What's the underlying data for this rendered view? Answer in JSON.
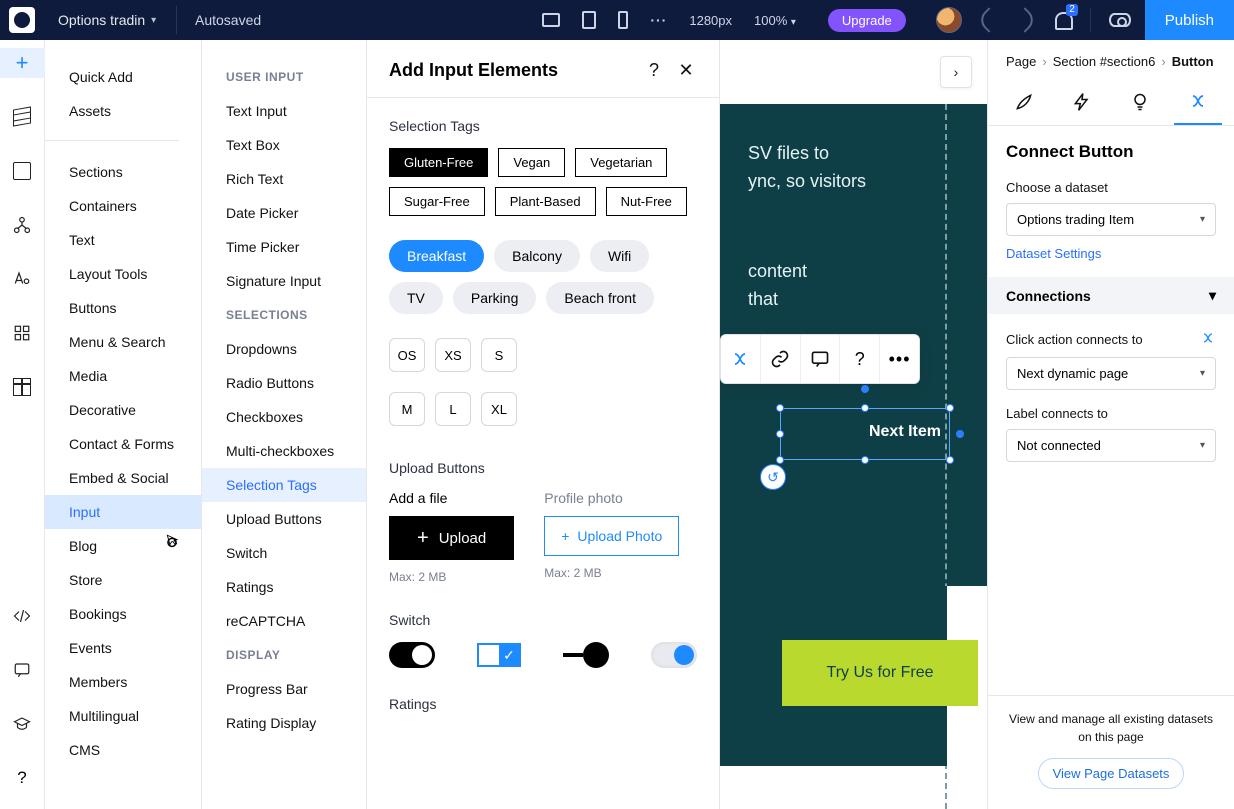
{
  "topbar": {
    "page_name": "Options tradin",
    "save_status": "Autosaved",
    "width_label": "1280px",
    "zoom_label": "100%",
    "upgrade_label": "Upgrade",
    "publish_label": "Publish",
    "notif_count": "2"
  },
  "cat": {
    "quick_add": "Quick Add",
    "assets": "Assets",
    "sections": "Sections",
    "containers": "Containers",
    "text": "Text",
    "layout_tools": "Layout Tools",
    "buttons": "Buttons",
    "menu_search": "Menu & Search",
    "media": "Media",
    "decorative": "Decorative",
    "contact_forms": "Contact & Forms",
    "embed_social": "Embed & Social",
    "input": "Input",
    "blog": "Blog",
    "store": "Store",
    "bookings": "Bookings",
    "events": "Events",
    "members": "Members",
    "multilingual": "Multilingual",
    "cms": "CMS"
  },
  "sub": {
    "head_user_input": "USER INPUT",
    "text_input": "Text Input",
    "text_box": "Text Box",
    "rich_text": "Rich Text",
    "date_picker": "Date Picker",
    "time_picker": "Time Picker",
    "signature_input": "Signature Input",
    "head_selections": "SELECTIONS",
    "dropdowns": "Dropdowns",
    "radio_buttons": "Radio Buttons",
    "checkboxes": "Checkboxes",
    "multi_checkboxes": "Multi-checkboxes",
    "selection_tags": "Selection Tags",
    "upload_buttons": "Upload Buttons",
    "switch": "Switch",
    "ratings": "Ratings",
    "recaptcha": "reCAPTCHA",
    "head_display": "DISPLAY",
    "progress_bar": "Progress Bar",
    "rating_display": "Rating Display"
  },
  "panel": {
    "title": "Add Input Elements",
    "sec_selection_tags": "Selection Tags",
    "tags1": {
      "a": "Gluten-Free",
      "b": "Vegan",
      "c": "Vegetarian",
      "d": "Sugar-Free",
      "e": "Plant-Based",
      "f": "Nut-Free"
    },
    "pills": {
      "a": "Breakfast",
      "b": "Balcony",
      "c": "Wifi",
      "d": "TV",
      "e": "Parking",
      "f": "Beach front"
    },
    "sizes": {
      "a": "OS",
      "b": "XS",
      "c": "S",
      "d": "M",
      "e": "L",
      "f": "XL"
    },
    "sec_upload_buttons": "Upload Buttons",
    "upload_add_label": "Add a file",
    "upload_btn": "Upload",
    "upload_max": "Max: 2 MB",
    "profile_label": "Profile photo",
    "profile_btn": "Upload Photo",
    "profile_max": "Max: 2 MB",
    "sec_switch": "Switch",
    "sec_ratings": "Ratings"
  },
  "canvas": {
    "hero_line1": "SV files to",
    "hero_line2": "ync, so visitors",
    "hero_line3": "content",
    "hero_line4": "that",
    "selected_label": "Next Item",
    "cta_label": "Try Us for Free"
  },
  "inspector": {
    "crumb_page": "Page",
    "crumb_section": "Section #section6",
    "crumb_button": "Button",
    "title": "Connect Button",
    "choose_dataset": "Choose a dataset",
    "dataset_value": "Options trading Item",
    "dataset_settings": "Dataset Settings",
    "connections_head": "Connections",
    "click_action_label": "Click action connects to",
    "click_action_value": "Next dynamic page",
    "label_connects_label": "Label connects to",
    "label_connects_value": "Not connected",
    "foot_text": "View and manage all existing datasets on this page",
    "foot_btn": "View Page Datasets"
  }
}
